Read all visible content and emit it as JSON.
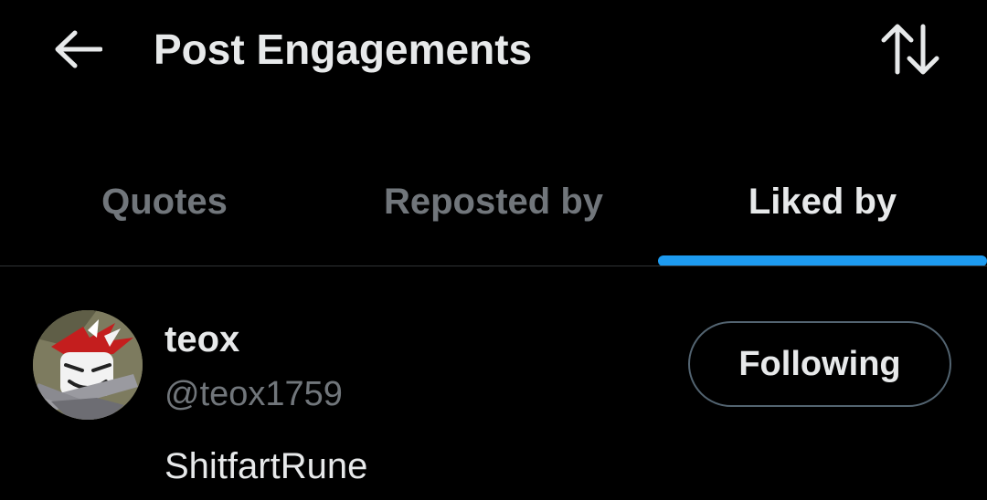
{
  "header": {
    "title": "Post Engagements",
    "back_icon": "arrow-left-icon",
    "sort_icon": "sort-arrows-icon"
  },
  "tabs": [
    {
      "label": "Quotes",
      "active": false
    },
    {
      "label": "Reposted by",
      "active": false
    },
    {
      "label": "Liked by",
      "active": true
    }
  ],
  "users": [
    {
      "name": "teox",
      "handle": "@teox1759",
      "bio": "ShitfartRune",
      "follow_label": "Following",
      "avatar_icon": "avatar-image"
    }
  ],
  "colors": {
    "background": "#000000",
    "text_primary": "#e7e9ea",
    "text_secondary": "#71767b",
    "accent": "#1d9bf0",
    "divider": "#2f3336",
    "button_border": "#536471"
  }
}
